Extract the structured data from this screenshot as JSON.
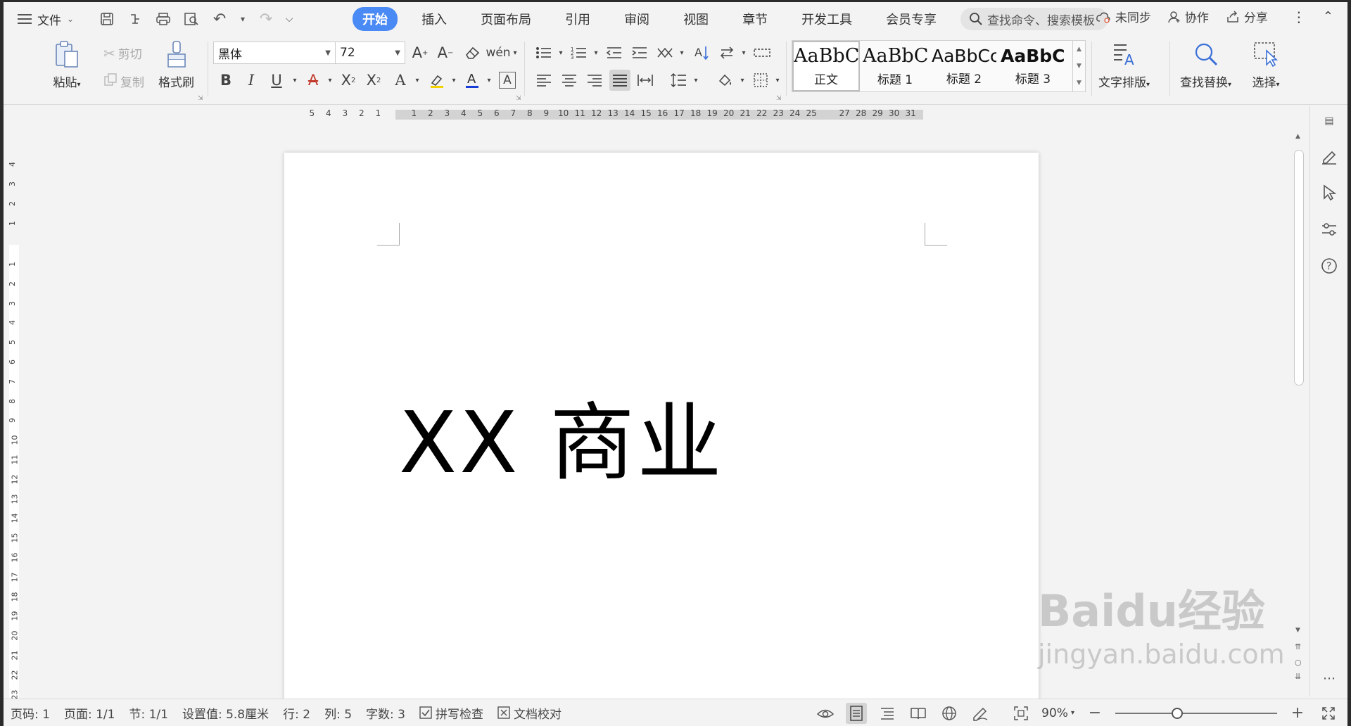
{
  "menubar": {
    "file_label": "文件",
    "tabs": [
      {
        "label": "开始",
        "active": true
      },
      {
        "label": "插入"
      },
      {
        "label": "页面布局"
      },
      {
        "label": "引用"
      },
      {
        "label": "审阅"
      },
      {
        "label": "视图"
      },
      {
        "label": "章节"
      },
      {
        "label": "开发工具"
      },
      {
        "label": "会员专享"
      }
    ],
    "search_placeholder": "查找命令、搜索模板",
    "sync_label": "未同步",
    "collab_label": "协作",
    "share_label": "分享"
  },
  "ribbon": {
    "paste_label": "粘贴",
    "cut_label": "剪切",
    "copy_label": "复制",
    "format_painter_label": "格式刷",
    "font_name": "黑体",
    "font_size": "72",
    "styles": [
      {
        "sample": "AaBbCcD",
        "name": "正文",
        "selected": true
      },
      {
        "sample": "AaBbCcD",
        "name": "标题 1"
      },
      {
        "sample": "AaBbCc",
        "name": "标题 2"
      },
      {
        "sample": "AaBbCc",
        "name": "标题 3"
      }
    ],
    "text_layout_label": "文字排版",
    "find_replace_label": "查找替换",
    "select_label": "选择"
  },
  "ruler": {
    "left_numbers": [
      "5",
      "4",
      "3",
      "2",
      "1"
    ],
    "right_numbers": [
      "1",
      "2",
      "3",
      "4",
      "5",
      "6",
      "7",
      "8",
      "9",
      "10",
      "11",
      "12",
      "13",
      "14",
      "15",
      "16",
      "17",
      "18",
      "19",
      "20",
      "21",
      "22",
      "23",
      "24",
      "25",
      "27",
      "28",
      "29",
      "30",
      "31"
    ],
    "vertical_top": [
      "4",
      "3",
      "2",
      "1"
    ],
    "vertical_bottom": [
      "1",
      "2",
      "3",
      "4",
      "5",
      "6",
      "7",
      "8",
      "9",
      "10",
      "11",
      "12",
      "13",
      "14",
      "15",
      "16",
      "17",
      "18",
      "19",
      "20",
      "21",
      "22",
      "23"
    ]
  },
  "document": {
    "title": "XX 商业"
  },
  "statusbar": {
    "page_code": "页码: 1",
    "page": "页面: 1/1",
    "section": "节: 1/1",
    "setting": "设置值: 5.8厘米",
    "row": "行: 2",
    "col": "列: 5",
    "word_count": "字数: 3",
    "spell_check": "拼写检查",
    "doc_proof": "文档校对",
    "zoom": "90%"
  },
  "watermark": {
    "brand": "Baidu经验",
    "url": "jingyan.baidu.com"
  },
  "colors": {
    "accent": "#4a8af4",
    "font_color_bar": "#1a3fd6",
    "highlight_bar": "#f3d200"
  }
}
